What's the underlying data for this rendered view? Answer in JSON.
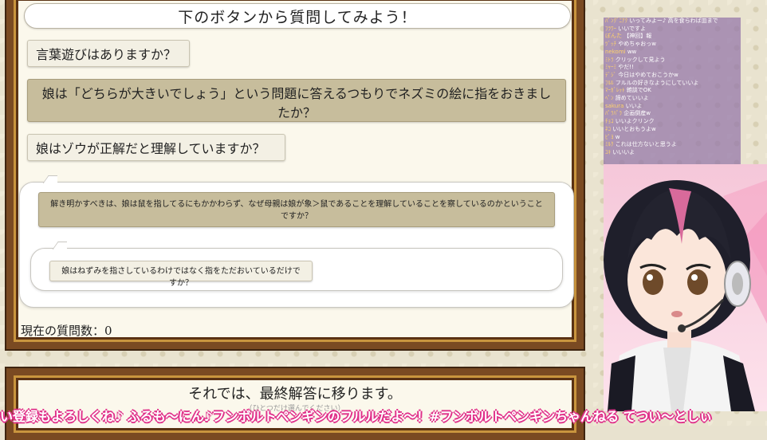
{
  "header": {
    "title": "下のボタンから質問してみよう！"
  },
  "questions": [
    {
      "label": "言葉遊びはありますか？"
    },
    {
      "label": "娘は「どちらが大きいでしょう」という問題に答えるつもりでネズミの絵に指をおきましたか？"
    },
    {
      "label": "娘はゾウが正解だと理解していますか？"
    }
  ],
  "sub_questions": {
    "level1": "解き明かすべきは、娘は鼠を指してるにもかかわらず、なぜ母親は娘が象＞鼠であることを理解していることを察しているのかということですか？",
    "level2": "娘はねずみを指さしているわけではなく指をただおいているだけですか？"
  },
  "status": {
    "question_count": "現在の質問数：0"
  },
  "final": {
    "text": "それでは、最終解答に移ります。",
    "sub": "（ひとつだけ選んでください）"
  },
  "chat": {
    "lines": [
      {
        "user": "ﾊﾟﾝｸﾞﾆｱｸ",
        "msg": "いってみよー♪ 高を食らわば皿まで"
      },
      {
        "user": "ﾌﾗﾜｰ",
        "msg": "いいですよ"
      },
      {
        "user": "ぽんた",
        "msg": "【神回】報"
      },
      {
        "user": "ﾂﾞｯﾁ",
        "msg": "やめちゃおっw"
      },
      {
        "user": "nekomi",
        "msg": "ww"
      },
      {
        "user": "ﾐﾄﾗ",
        "msg": "クリックして見よう"
      },
      {
        "user": "ﾐｬｰﾐ",
        "msg": "やだ!!"
      },
      {
        "user": "ﾃﾞｼﾞ",
        "msg": "今日はやめておこうかw"
      },
      {
        "user": "ﾌﾙﾙ",
        "msg": "フルルの好きなようにしていいよ"
      },
      {
        "user": "ﾏｰｶﾞﾚｯﾄ",
        "msg": "雑談でOK"
      },
      {
        "user": "ﾍﾟﾝ",
        "msg": "諦めていいよ"
      },
      {
        "user": "sakura",
        "msg": "いいよ"
      },
      {
        "user": "ﾊﾟﾗﾊﾟﾗ",
        "msg": "企画倒産w"
      },
      {
        "user": "ﾁｮｺ",
        "msg": "いいよクリンク"
      },
      {
        "user": "ﾈｺ",
        "msg": "いいとおもうよw"
      },
      {
        "user": "ﾋﾟﾖ",
        "msg": "w"
      },
      {
        "user": "ﾐﾙｸ",
        "msg": "これは仕方ないと思うよ"
      },
      {
        "user": "ﾕｷ",
        "msg": "いいいよ"
      }
    ]
  },
  "ticker": {
    "text": "い登録もよろしくね♪ ふるも〜にん♪フンボルトペンギンのフルルだよ〜！#フンボルトペンギンちゃんねる てつい〜としぃ"
  },
  "colors": {
    "frame": "#7a4a22",
    "gold": "#c9953e",
    "selected": "#c7bd9c",
    "ticker_outline": "#e0318a"
  }
}
